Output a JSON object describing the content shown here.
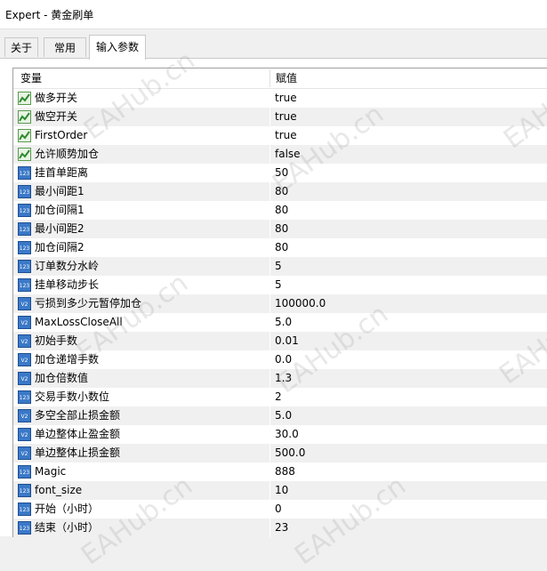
{
  "window": {
    "title": "Expert - 黄金刷单"
  },
  "tabs": [
    {
      "label": "关于",
      "active": false
    },
    {
      "label": "常用",
      "active": false
    },
    {
      "label": "输入参数",
      "active": true
    }
  ],
  "table": {
    "headers": {
      "variable": "变量",
      "value": "赋值"
    },
    "rows": [
      {
        "type": "bool",
        "name": "做多开关",
        "value": "true"
      },
      {
        "type": "bool",
        "name": "做空开关",
        "value": "true"
      },
      {
        "type": "bool",
        "name": "FirstOrder",
        "value": "true"
      },
      {
        "type": "bool",
        "name": "允许顺势加仓",
        "value": "false"
      },
      {
        "type": "int",
        "name": "挂首单距离",
        "value": "50"
      },
      {
        "type": "int",
        "name": "最小间距1",
        "value": "80"
      },
      {
        "type": "int",
        "name": "加仓间隔1",
        "value": "80"
      },
      {
        "type": "int",
        "name": "最小间距2",
        "value": "80"
      },
      {
        "type": "int",
        "name": "加仓间隔2",
        "value": "80"
      },
      {
        "type": "int",
        "name": "订单数分水岭",
        "value": "5"
      },
      {
        "type": "int",
        "name": "挂单移动步长",
        "value": "5"
      },
      {
        "type": "dbl",
        "name": "亏损到多少元暂停加仓",
        "value": "100000.0"
      },
      {
        "type": "dbl",
        "name": "MaxLossCloseAll",
        "value": "5.0"
      },
      {
        "type": "dbl",
        "name": "初始手数",
        "value": "0.01"
      },
      {
        "type": "dbl",
        "name": "加仓递增手数",
        "value": "0.0"
      },
      {
        "type": "dbl",
        "name": "加仓倍数值",
        "value": "1.3"
      },
      {
        "type": "int",
        "name": "交易手数小数位",
        "value": "2"
      },
      {
        "type": "dbl",
        "name": "多空全部止损金额",
        "value": "5.0"
      },
      {
        "type": "dbl",
        "name": "单边整体止盈金额",
        "value": "30.0"
      },
      {
        "type": "dbl",
        "name": "单边整体止损金额",
        "value": "500.0"
      },
      {
        "type": "int",
        "name": "Magic",
        "value": "888"
      },
      {
        "type": "int",
        "name": "font_size",
        "value": "10"
      },
      {
        "type": "int",
        "name": "开始（小时）",
        "value": "0"
      },
      {
        "type": "int",
        "name": "结束（小时）",
        "value": "23"
      }
    ]
  },
  "watermark": {
    "text": "EAHub.cn"
  }
}
